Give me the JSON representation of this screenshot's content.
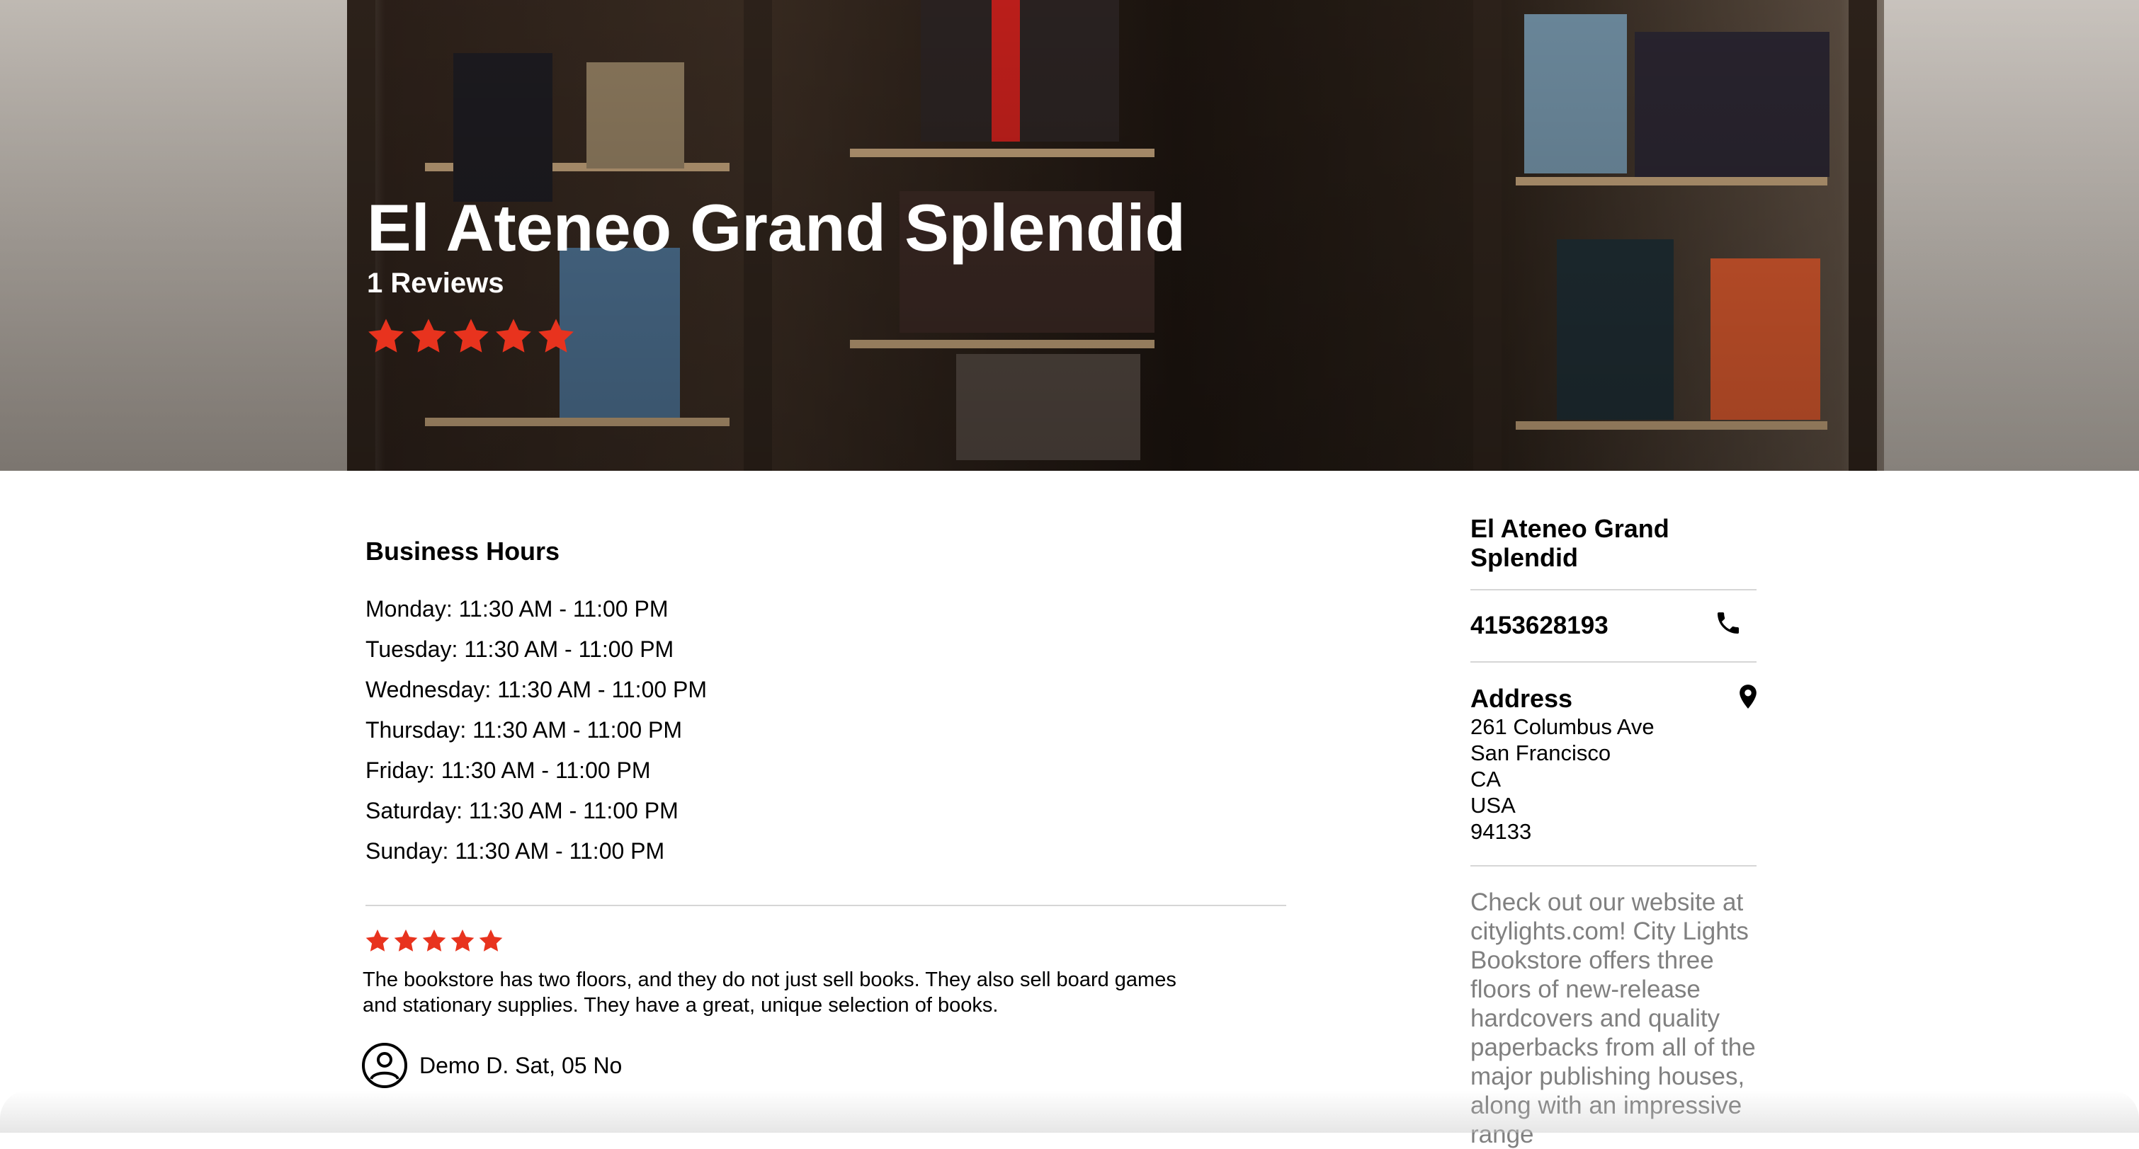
{
  "colors": {
    "star": "#e8331e",
    "muted_text": "#808080",
    "divider": "#d6d6d6"
  },
  "hero": {
    "title": "El Ateneo Grand Splendid",
    "reviews": "1 Reviews",
    "rating": 5,
    "star_icon": "star-icon"
  },
  "hours": {
    "title": "Business Hours",
    "items": [
      "Monday: 11:30 AM - 11:00 PM",
      "Tuesday: 11:30 AM - 11:00 PM",
      "Wednesday: 11:30 AM - 11:00 PM",
      "Thursday: 11:30 AM - 11:00 PM",
      "Friday: 11:30 AM - 11:00 PM",
      "Saturday: 11:30 AM - 11:00 PM",
      "Sunday: 11:30 AM - 11:00 PM"
    ]
  },
  "review": {
    "rating": 5,
    "text": "The bookstore has two floors, and they do not just sell books.  They also sell board games and stationary supplies.  They have a great, unique selection of books.",
    "author": "Demo D. Sat, 05 No",
    "avatar_icon": "user-circle-icon"
  },
  "sidebar": {
    "name": "El Ateneo Grand Splendid",
    "phone": "4153628193",
    "phone_icon": "phone-icon",
    "address_label": "Address",
    "address_icon": "map-pin-icon",
    "address_lines": [
      "261 Columbus Ave",
      "San Francisco",
      "CA",
      "USA",
      "94133"
    ],
    "description": "Check out our website at citylights.com! City Lights Bookstore offers three floors of new-release hardcovers and quality paperbacks from all of the major publishing houses, along with an impressive range"
  }
}
